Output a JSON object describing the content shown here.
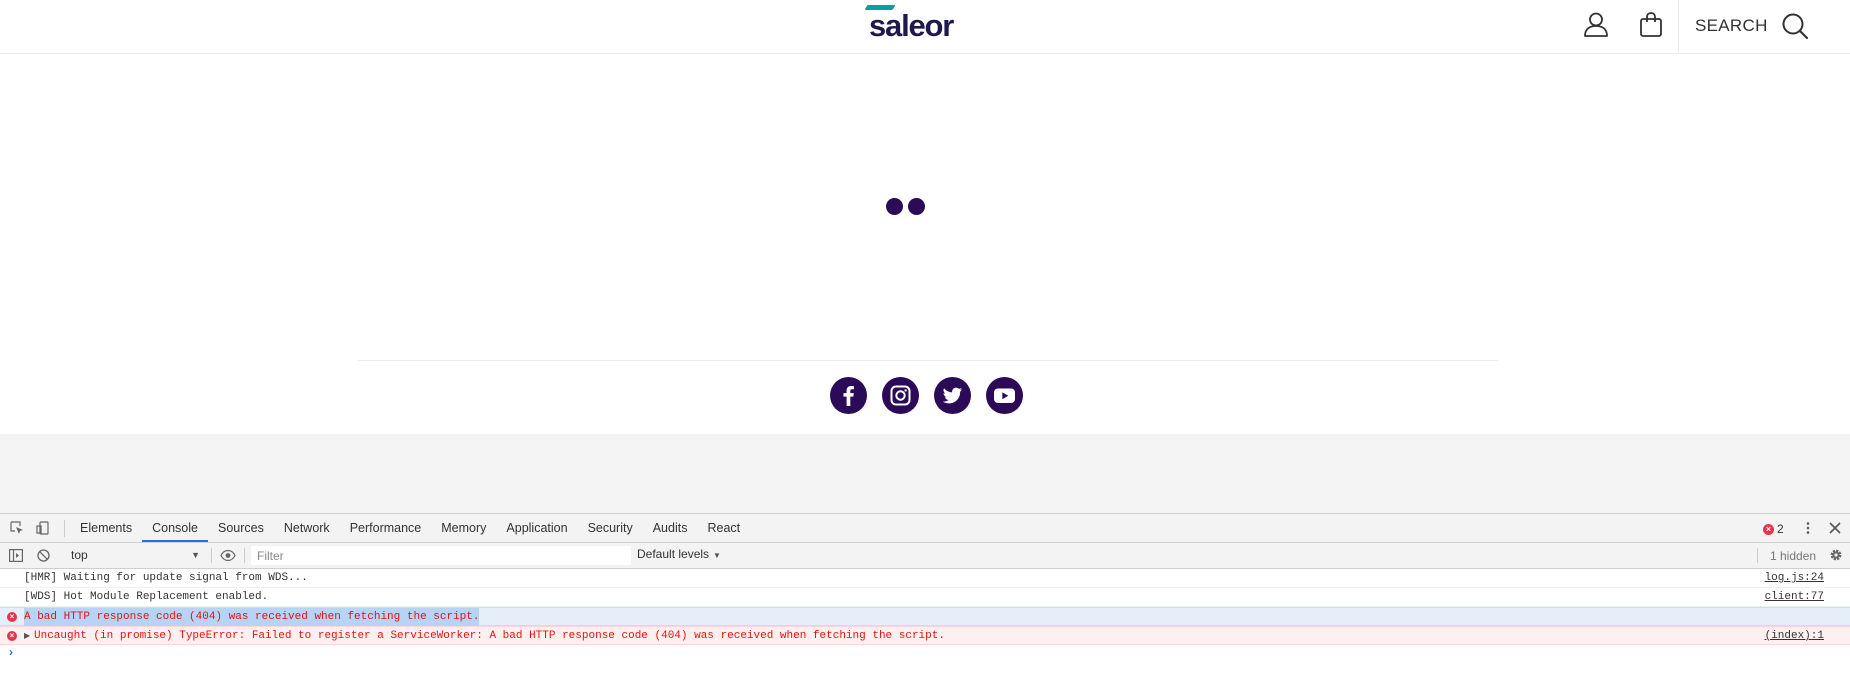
{
  "store": {
    "logo_text": "saleor",
    "search_label": "SEARCH",
    "colors": {
      "brand_dark": "#2b0b58",
      "logo_accent": "#06a09e",
      "logo_text": "#1e1850"
    },
    "header_icons": [
      "user-icon",
      "shopping-bag-icon",
      "search-icon"
    ],
    "social_icons": [
      "facebook-icon",
      "instagram-icon",
      "twitter-icon",
      "youtube-icon"
    ]
  },
  "devtools": {
    "tabs": [
      {
        "label": "Elements"
      },
      {
        "label": "Console"
      },
      {
        "label": "Sources"
      },
      {
        "label": "Network"
      },
      {
        "label": "Performance"
      },
      {
        "label": "Memory"
      },
      {
        "label": "Application"
      },
      {
        "label": "Security"
      },
      {
        "label": "Audits"
      },
      {
        "label": "React"
      }
    ],
    "active_tab": "Console",
    "error_count": "2",
    "context": "top",
    "filter_placeholder": "Filter",
    "filter_value": "",
    "levels_label": "Default levels",
    "hidden_label": "1 hidden",
    "messages": [
      {
        "level": "log",
        "text": "[HMR] Waiting for update signal from WDS...",
        "source": "log.js:24"
      },
      {
        "level": "log",
        "text": "[WDS] Hot Module Replacement enabled.",
        "source": "client:77"
      },
      {
        "level": "error",
        "text": "A bad HTTP response code (404) was received when fetching the script.",
        "source": "",
        "selected": true
      },
      {
        "level": "error",
        "text": "Uncaught (in promise) TypeError: Failed to register a ServiceWorker: A bad HTTP response code (404) was received when fetching the script.",
        "source": "(index):1"
      }
    ],
    "colors": {
      "active_tab_underline": "#1a73e8",
      "error_text": "#e41313",
      "error_icon": "#e8344b"
    }
  }
}
